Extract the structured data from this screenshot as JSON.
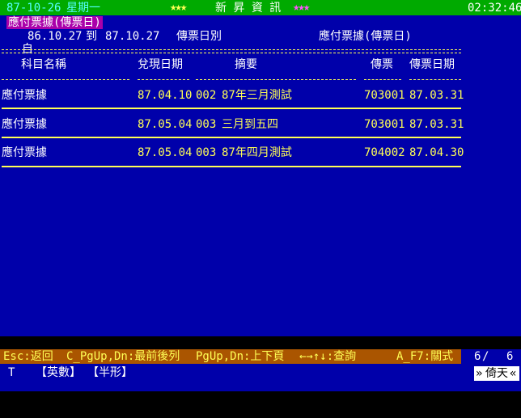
{
  "header": {
    "date": "87-10-26",
    "weekday": "星期一",
    "stars_left": "★★★",
    "app_name": "新 昇 資 訊",
    "stars_right": "★★★",
    "time": "02:32:46"
  },
  "report": {
    "title": "應付票據(傳票日)",
    "from_label": "自",
    "from_date": "86.10.27",
    "to_label": "到",
    "to_date": "87.10.27",
    "sort_label": "傳票日別",
    "report_name": "應付票據(傳票日)"
  },
  "table": {
    "columns": [
      "科目名稱",
      "兌現日期",
      "摘要",
      "傳票",
      "傳票日期"
    ],
    "rows": [
      {
        "account": "應付票據",
        "due_date": "87.04.10",
        "seq": "002",
        "summary": "87年三月測試",
        "voucher": "703001",
        "voucher_date": "87.03.31"
      },
      {
        "account": "應付票據",
        "due_date": "87.05.04",
        "seq": "003",
        "summary": "三月到五四",
        "voucher": "703001",
        "voucher_date": "87.03.31"
      },
      {
        "account": "應付票據",
        "due_date": "87.05.04",
        "seq": "003",
        "summary": "87年四月測試",
        "voucher": "704002",
        "voucher_date": "87.04.30"
      }
    ]
  },
  "function_keys": {
    "esc": "Esc:返回",
    "cpg": "C_PgUp,Dn:最前後列",
    "pg": "PgUp,Dn:上下頁",
    "arrows": "←→↑↓:查詢",
    "af7": "A_F7:關式",
    "page_current": "6",
    "page_sep": "/",
    "page_total": "6"
  },
  "status": {
    "mode": "T",
    "input_mode": "【英數】",
    "width_mode": "【半形】",
    "logo": "倚天"
  },
  "colors": {
    "top_bar": "#00aa00",
    "main_bg": "#0000aa",
    "fn_bar": "#aa5500",
    "highlight": "#aa00aa",
    "text_yellow": "#ffff55"
  }
}
